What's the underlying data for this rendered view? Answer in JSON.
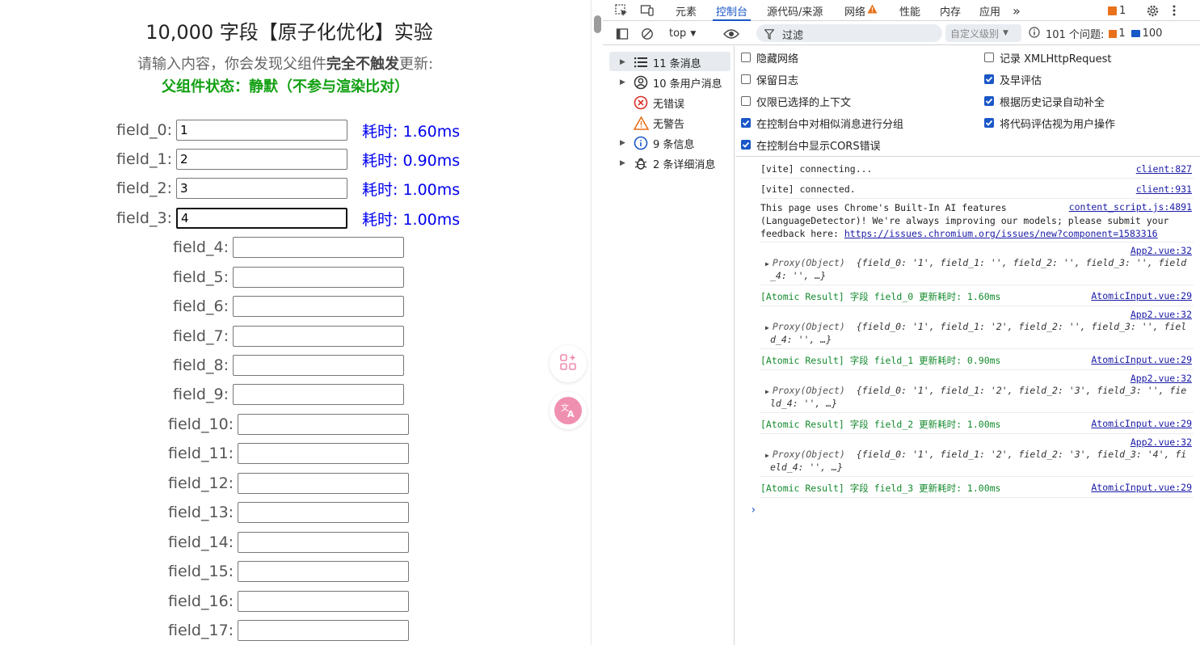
{
  "page": {
    "title": "10,000 字段【原子化优化】实验",
    "desc_prefix": "请输入内容，你会发现父组件",
    "desc_bold": "完全不触发",
    "desc_suffix": "更新:",
    "status": "父组件状态：静默（不参与渲染比对）",
    "fields": [
      {
        "label": "field_0:",
        "value": "1",
        "time": "耗时: 1.60ms"
      },
      {
        "label": "field_1:",
        "value": "2",
        "time": "耗时: 0.90ms"
      },
      {
        "label": "field_2:",
        "value": "3",
        "time": "耗时: 1.00ms"
      },
      {
        "label": "field_3:",
        "value": "4",
        "time": "耗时: 1.00ms"
      },
      {
        "label": "field_4:",
        "value": "",
        "time": ""
      },
      {
        "label": "field_5:",
        "value": "",
        "time": ""
      },
      {
        "label": "field_6:",
        "value": "",
        "time": ""
      },
      {
        "label": "field_7:",
        "value": "",
        "time": ""
      },
      {
        "label": "field_8:",
        "value": "",
        "time": ""
      },
      {
        "label": "field_9:",
        "value": "",
        "time": ""
      },
      {
        "label": "field_10:",
        "value": "",
        "time": ""
      },
      {
        "label": "field_11:",
        "value": "",
        "time": ""
      },
      {
        "label": "field_12:",
        "value": "",
        "time": ""
      },
      {
        "label": "field_13:",
        "value": "",
        "time": ""
      },
      {
        "label": "field_14:",
        "value": "",
        "time": ""
      },
      {
        "label": "field_15:",
        "value": "",
        "time": ""
      },
      {
        "label": "field_16:",
        "value": "",
        "time": ""
      },
      {
        "label": "field_17:",
        "value": "",
        "time": ""
      }
    ],
    "float_buttons": [
      "ai-sparkle-icon",
      "translate-icon"
    ]
  },
  "devtools": {
    "tabs": [
      "元素",
      "控制台",
      "源代码/来源",
      "网络",
      "性能",
      "内存",
      "应用"
    ],
    "active_tab": "控制台",
    "more": "»",
    "issues_badge": "1",
    "toolbar": {
      "context": "top",
      "filter_placeholder": "过滤",
      "levels": "自定义级别",
      "issues_label": "101 个问题:",
      "issues_warn": "1",
      "issues_info": "100"
    },
    "sidebar": [
      {
        "label": "11 条消息",
        "icon": "list-icon"
      },
      {
        "label": "10 条用户消息",
        "icon": "user-icon"
      },
      {
        "label": "无错误",
        "icon": "error-icon"
      },
      {
        "label": "无警告",
        "icon": "warning-icon"
      },
      {
        "label": "9 条信息",
        "icon": "info-icon"
      },
      {
        "label": "2 条详细消息",
        "icon": "bug-icon"
      }
    ],
    "settings": [
      {
        "label": "隐藏网络",
        "checked": false
      },
      {
        "label": "记录 XMLHttpRequest",
        "checked": false
      },
      {
        "label": "保留日志",
        "checked": false
      },
      {
        "label": "及早评估",
        "checked": true
      },
      {
        "label": "仅限已选择的上下文",
        "checked": false
      },
      {
        "label": "根据历史记录自动补全",
        "checked": true
      },
      {
        "label": "在控制台中对相似消息进行分组",
        "checked": true
      },
      {
        "label": "将代码评估视为用户操作",
        "checked": true
      },
      {
        "label": "在控制台中显示CORS错误",
        "checked": true
      }
    ],
    "console": {
      "vite_connecting": "[vite] connecting...",
      "vite_connecting_src": "client:827",
      "vite_connected": "[vite] connected.",
      "vite_connected_src": "client:931",
      "ai_msg_1": "This page uses Chrome's Built-In AI features",
      "ai_msg_2": "(LanguageDetector)! We're always improving our models; please submit your",
      "ai_msg_3": "feedback here: ",
      "ai_link": "https://issues.chromium.org/issues/new?component=1583316",
      "ai_src": "content_script.js:4891",
      "app_src": "App2.vue:32",
      "atomic_src": "AtomicInput.vue:29",
      "proxy_label": "Proxy(Object)",
      "proxy_1a": "{field_0: '1', field_1: '', field_2: '', field_3: '', field",
      "proxy_1b": "_4: '',  …}",
      "proxy_2a": "{field_0: '1', field_1: '2', field_2: '', field_3: '', fiel",
      "proxy_2b": "d_4: '',  …}",
      "proxy_3a": "{field_0: '1', field_1: '2', field_2: '3', field_3: '', fie",
      "proxy_3b": "ld_4: '',  …}",
      "proxy_4a": "{field_0: '1', field_1: '2', field_2: '3', field_3: '4', fi",
      "proxy_4b": "eld_4: '',  …}",
      "atomic_0": "[Atomic Result] 字段 field_0 更新耗时: 1.60ms",
      "atomic_1": "[Atomic Result] 字段 field_1 更新耗时: 0.90ms",
      "atomic_2": "[Atomic Result] 字段 field_2 更新耗时: 1.00ms",
      "atomic_3": "[Atomic Result] 字段 field_3 更新耗时: 1.00ms",
      "prompt": "›"
    }
  },
  "colors": {
    "accent_blue": "#1a57c7",
    "time_blue": "#0000ee",
    "status_green": "#12a012",
    "console_green": "#128a2c",
    "warn_orange": "#e8711a"
  }
}
